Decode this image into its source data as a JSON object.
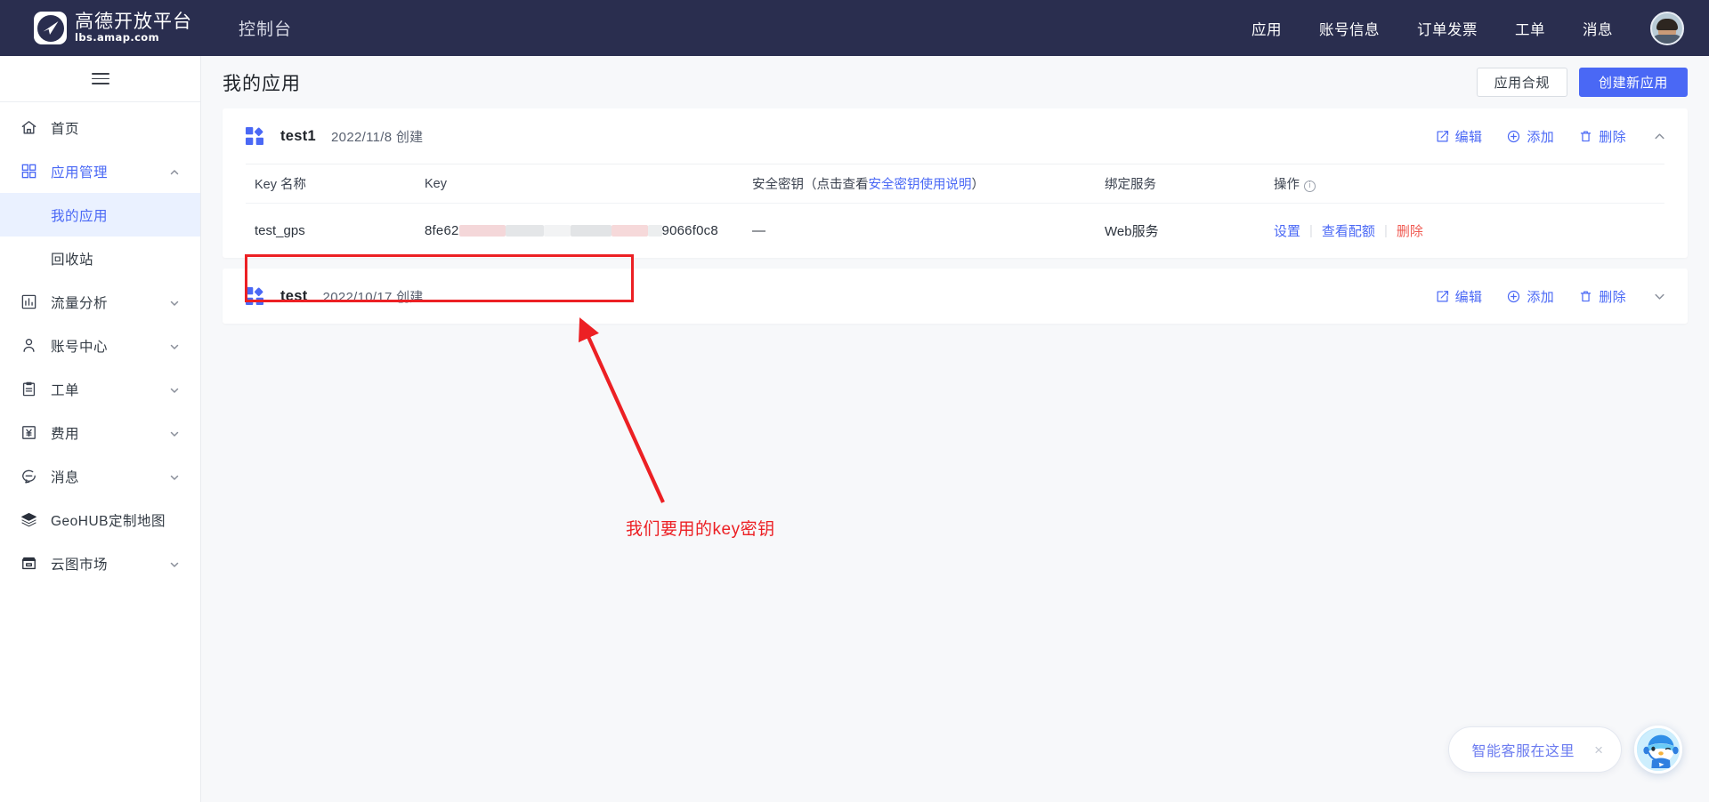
{
  "topnav": {
    "brand_title": "高德开放平台",
    "brand_sub": "lbs.amap.com",
    "console_label": "控制台",
    "items": [
      {
        "label": "应用"
      },
      {
        "label": "账号信息"
      },
      {
        "label": "订单发票"
      },
      {
        "label": "工单"
      },
      {
        "label": "消息"
      }
    ]
  },
  "sidebar": {
    "items": [
      {
        "label": "首页",
        "icon": "home-icon",
        "expandable": false,
        "active": false
      },
      {
        "label": "应用管理",
        "icon": "apps-grid-icon",
        "expandable": true,
        "expanded": true,
        "active": true
      },
      {
        "label": "流量分析",
        "icon": "chart-icon",
        "expandable": true,
        "expanded": false,
        "active": false
      },
      {
        "label": "账号中心",
        "icon": "user-icon",
        "expandable": true,
        "expanded": false,
        "active": false
      },
      {
        "label": "工单",
        "icon": "clipboard-icon",
        "expandable": true,
        "expanded": false,
        "active": false
      },
      {
        "label": "费用",
        "icon": "yuan-icon",
        "expandable": true,
        "expanded": false,
        "active": false
      },
      {
        "label": "消息",
        "icon": "chat-icon",
        "expandable": true,
        "expanded": false,
        "active": false
      },
      {
        "label": "GeoHUB定制地图",
        "icon": "layers-icon",
        "expandable": false,
        "active": false
      },
      {
        "label": "云图市场",
        "icon": "store-icon",
        "expandable": true,
        "expanded": false,
        "active": false
      }
    ],
    "submenu": [
      {
        "label": "我的应用",
        "selected": true
      },
      {
        "label": "回收站",
        "selected": false
      }
    ]
  },
  "page": {
    "title": "我的应用",
    "compliance_button": "应用合规",
    "create_button": "创建新应用"
  },
  "table_headers": {
    "key_name": "Key 名称",
    "key": "Key",
    "security_prefix": "安全密钥（点击查看",
    "security_link": "安全密钥使用说明",
    "security_suffix": "）",
    "bind_service": "绑定服务",
    "operation": "操作"
  },
  "card_actions": {
    "edit": "编辑",
    "add": "添加",
    "delete": "删除"
  },
  "row_actions": {
    "settings": "设置",
    "view_quota": "查看配额",
    "delete": "删除"
  },
  "apps": [
    {
      "name": "test1",
      "date": "2022/11/8 创建",
      "expanded": true,
      "keys": [
        {
          "key_name": "test_gps",
          "key_prefix": "8fe62",
          "key_suffix": "9066f0c8",
          "security": "—",
          "bind_service": "Web服务"
        }
      ]
    },
    {
      "name": "test",
      "date": "2022/10/17 创建",
      "expanded": false,
      "keys": []
    }
  ],
  "annotation": {
    "text": "我们要用的key密钥",
    "color": "#ec2024"
  },
  "customer_service": {
    "text": "智能客服在这里",
    "close_label": "×"
  },
  "colors": {
    "accent": "#4a68f5",
    "nav_bg": "#2a2e4f",
    "danger": "#f05a52",
    "annotation_red": "#ec2024",
    "page_bg": "#f7f8fa"
  }
}
